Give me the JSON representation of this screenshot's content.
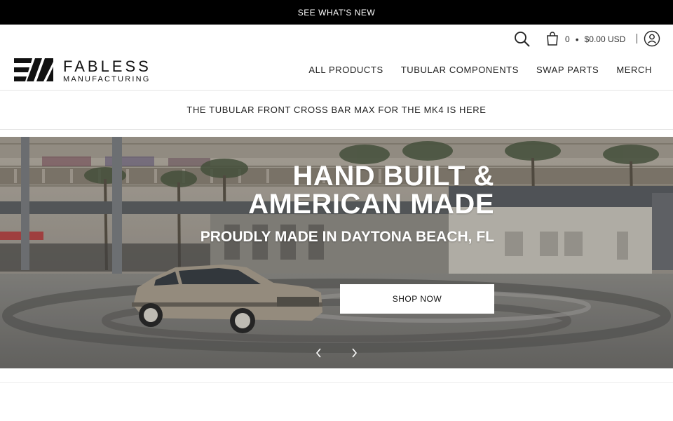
{
  "announcement": {
    "text": "SEE WHAT'S NEW"
  },
  "header": {
    "cart": {
      "count": "0",
      "dot": "•",
      "total": "$0.00 USD"
    },
    "logo": {
      "name": "FABLESS",
      "sub": "MANUFACTURING"
    },
    "nav": [
      {
        "label": "ALL PRODUCTS"
      },
      {
        "label": "TUBULAR COMPONENTS"
      },
      {
        "label": "SWAP PARTS"
      },
      {
        "label": "MERCH"
      }
    ]
  },
  "promo": {
    "text": "THE TUBULAR FRONT CROSS BAR MAX FOR THE MK4 IS HERE"
  },
  "hero": {
    "title_line1": "HAND BUILT &",
    "title_line2": "AMERICAN MADE",
    "subtitle": "PROUDLY MADE IN DAYTONA BEACH, FL",
    "cta": "SHOP NOW"
  },
  "icons": {
    "search": "search-icon",
    "cart": "cart-icon",
    "account": "user-icon",
    "prev": "chevron-left-icon",
    "next": "chevron-right-icon"
  },
  "colors": {
    "announcement_bg": "#000000",
    "text": "#222222",
    "hero_text": "#ffffff",
    "button_bg": "#ffffff"
  }
}
